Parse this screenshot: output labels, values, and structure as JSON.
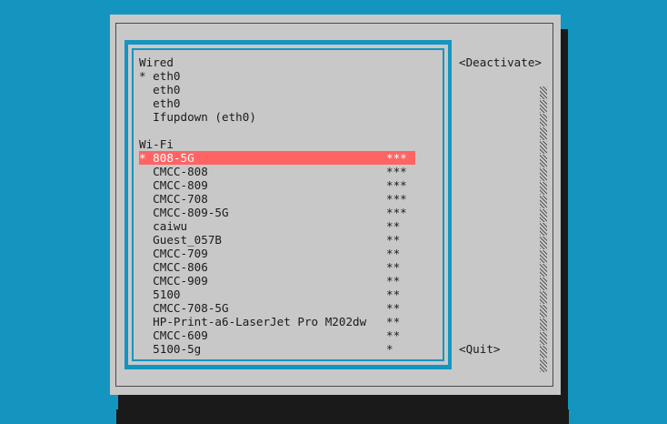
{
  "dialog": {
    "buttons": {
      "deactivate": "<Deactivate>",
      "quit": "<Quit>"
    },
    "sections": {
      "wired": "Wired",
      "wifi": "Wi-Fi"
    },
    "wired_items": [
      {
        "name": "* eth0"
      },
      {
        "name": "  eth0"
      },
      {
        "name": "  eth0"
      },
      {
        "name": "  Ifupdown (eth0)"
      }
    ],
    "wifi_items": [
      {
        "name": "* 808-5G",
        "signal": "***"
      },
      {
        "name": "  CMCC-808",
        "signal": "***"
      },
      {
        "name": "  CMCC-809",
        "signal": "***"
      },
      {
        "name": "  CMCC-708",
        "signal": "***"
      },
      {
        "name": "  CMCC-809-5G",
        "signal": "***"
      },
      {
        "name": "  caiwu",
        "signal": "**"
      },
      {
        "name": "  Guest_057B",
        "signal": "**"
      },
      {
        "name": "  CMCC-709",
        "signal": "**"
      },
      {
        "name": "  CMCC-806",
        "signal": "**"
      },
      {
        "name": "  CMCC-909",
        "signal": "**"
      },
      {
        "name": "  5100",
        "signal": "**"
      },
      {
        "name": "  CMCC-708-5G",
        "signal": "**"
      },
      {
        "name": "  HP-Print-a6-LaserJet Pro M202dw",
        "signal": "**"
      },
      {
        "name": "  CMCC-609",
        "signal": "**"
      },
      {
        "name": "  5100-5g",
        "signal": "*"
      }
    ],
    "colors": {
      "background": "#1495c0",
      "dialog": "#c8c8c8",
      "selection": "#ff6464"
    }
  }
}
